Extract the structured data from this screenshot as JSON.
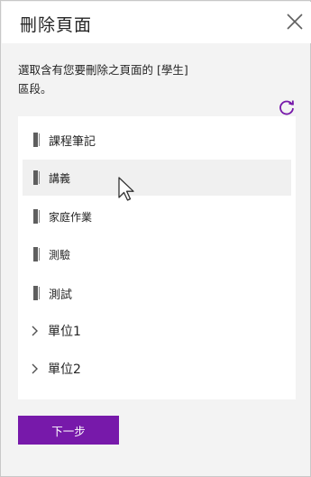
{
  "dialog": {
    "title": "刪除頁面",
    "instruction": "選取含有您要刪除之頁面的 [學生] 區段。",
    "next_label": "下一步",
    "close_icon": "close-icon",
    "refresh_icon": "refresh-icon"
  },
  "sections": [
    {
      "label": "課程筆記",
      "type": "section"
    },
    {
      "label": "講義",
      "type": "section",
      "hovered": true
    },
    {
      "label": "家庭作業",
      "type": "section"
    },
    {
      "label": "測驗",
      "type": "section"
    },
    {
      "label": "測試",
      "type": "section"
    },
    {
      "label": "單位1",
      "type": "group"
    },
    {
      "label": "單位2",
      "type": "group"
    }
  ],
  "colors": {
    "accent": "#7719aa",
    "background": "#f3f3f3",
    "panel": "#ffffff",
    "hover": "#f0f0f0"
  }
}
